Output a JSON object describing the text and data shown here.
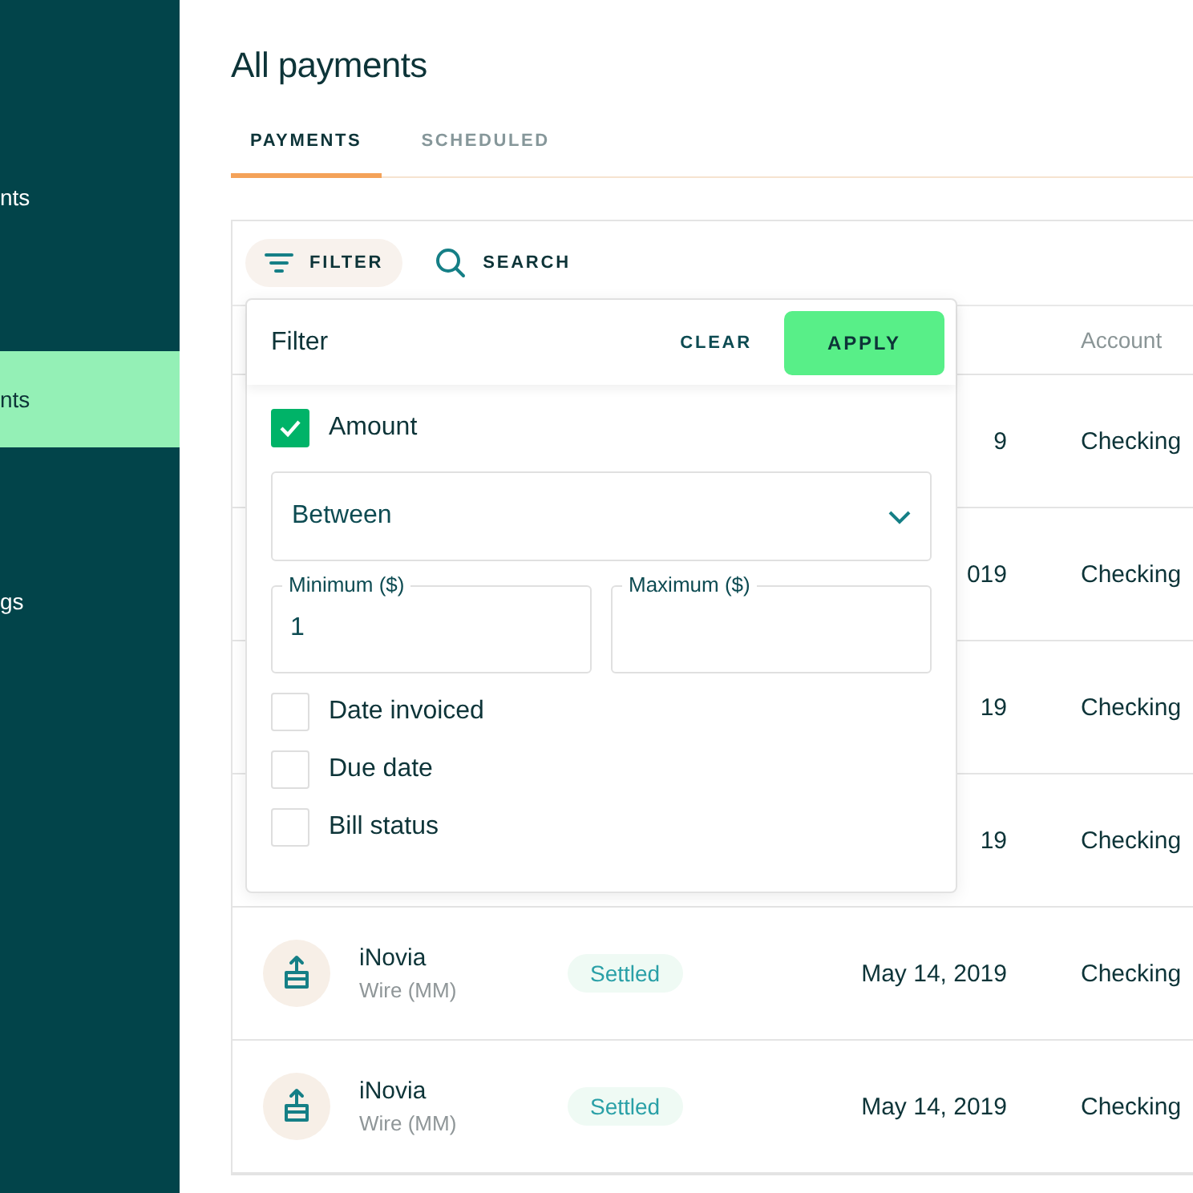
{
  "sidebar": {
    "items": [
      {
        "label": "nts",
        "selected": false
      },
      {
        "label": "nts",
        "selected": true
      },
      {
        "label": "gs",
        "selected": false
      }
    ]
  },
  "page_title": "All payments",
  "tabs": [
    {
      "label": "PAYMENTS",
      "selected": true
    },
    {
      "label": "SCHEDULED",
      "selected": false
    }
  ],
  "toolbar": {
    "filter_button": "FILTER",
    "search_button": "SEARCH"
  },
  "table": {
    "account_column": "Account",
    "rows": [
      {
        "date": "9",
        "account": "Checking"
      },
      {
        "date": "019",
        "account": "Checking"
      },
      {
        "date": "19",
        "account": "Checking"
      },
      {
        "date": "19",
        "account": "Checking"
      },
      {
        "payee": "iNovia",
        "method": "Wire (MM)",
        "status": "Settled",
        "date": "May 14, 2019",
        "account": "Checking"
      },
      {
        "payee": "iNovia",
        "method": "Wire (MM)",
        "status": "Settled",
        "date": "May 14, 2019",
        "account": "Checking"
      }
    ]
  },
  "filter_panel": {
    "title": "Filter",
    "clear_button": "CLEAR",
    "apply_button": "APPLY",
    "criteria": [
      {
        "kind": "checkbox",
        "label": "Amount",
        "checked": true
      },
      {
        "kind": "select",
        "value": "Between"
      },
      {
        "kind": "range",
        "fields": [
          {
            "label": "Minimum ($)",
            "value": "1"
          },
          {
            "label": "Maximum ($)"
          }
        ]
      },
      {
        "kind": "checkbox",
        "label": "Date invoiced",
        "checked": false
      },
      {
        "kind": "checkbox",
        "label": "Due date",
        "checked": false
      },
      {
        "kind": "checkbox",
        "label": "Bill status",
        "checked": false
      }
    ]
  }
}
